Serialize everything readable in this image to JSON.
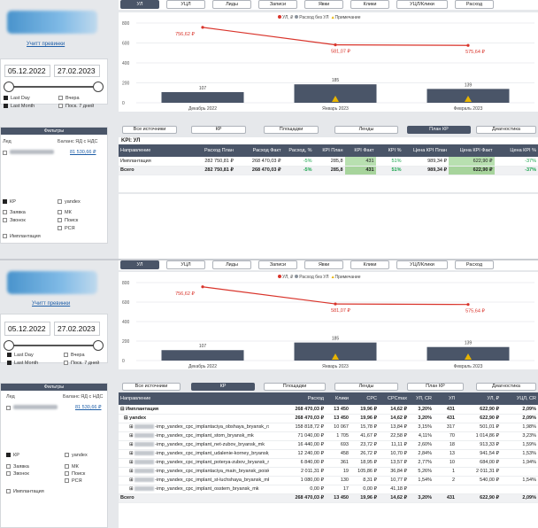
{
  "left": {
    "help_link": "Учитт превинки",
    "date_from": "05.12.2022",
    "date_to": "27.02.2023",
    "period_options": [
      "Last Day",
      "Вчера",
      "Last Month",
      "Поск. 7 дней"
    ],
    "filters_title": "Фильтры",
    "col_led": "Лед",
    "col_balance": "Баланс ЯД с НДС",
    "balance_value": "81 530,66 ₽",
    "channels": [
      "КР",
      "yandex",
      "Заявка",
      "МК",
      "Звонок",
      "Поиск",
      "РСЯ",
      "Имплантация"
    ]
  },
  "tabs": [
    "УЛ",
    "УЦЛ",
    "Лиды",
    "Записи",
    "Явки",
    "Клики",
    "УЦЛ/Клики",
    "Расход"
  ],
  "active_tab": "УЛ",
  "chart": {
    "legend": "● УЛ, ₽ ● Расход без УЛ ▲ Примечание",
    "legend_items": [
      "УЛ, ₽",
      "Расход без УЛ",
      "Примечание"
    ],
    "colors": {
      "line": "#d9342b",
      "bar": "#4a5568",
      "note": "#e8b400"
    },
    "chart_data": {
      "type": "bar",
      "categories": [
        "Декабрь 2022",
        "Январь 2023",
        "Февраль 2023"
      ],
      "series": [
        {
          "name": "Расход без УЛ",
          "values": [
            107,
            185,
            139
          ]
        },
        {
          "name": "УЛ, ₽",
          "values": [
            756.62,
            581.07,
            575.64
          ]
        }
      ],
      "line_labels": [
        "756,62 ₽",
        "581,07 ₽",
        "575,64 ₽"
      ],
      "y_ticks": [
        "800",
        "600",
        "400",
        "200",
        "0"
      ],
      "ylim": [
        0,
        800
      ]
    }
  },
  "sources": [
    "Все источники",
    "КР",
    "Площадки",
    "Ленды",
    "План КР",
    "Диагностика"
  ],
  "view1": {
    "active_source": "План КР",
    "kpi_title": "KPI: УЛ",
    "headers": [
      "Направление",
      "Расход План",
      "Расход Факт",
      "Расход, %",
      "КРІ План",
      "КРІ Факт",
      "КРІ %",
      "Цена КРІ План",
      "Цена КРІ Факт",
      "Цена КРІ %"
    ],
    "rows": [
      [
        "Имплантация",
        "282 750,81 ₽",
        "268 470,03 ₽",
        "-5%",
        "285,8",
        "431",
        "51%",
        "989,34 ₽",
        "622,90 ₽",
        "-37%"
      ]
    ],
    "total": [
      "Всего",
      "282 750,81 ₽",
      "268 470,03 ₽",
      "-5%",
      "285,8",
      "431",
      "51%",
      "989,34 ₽",
      "622,90 ₽",
      "-37%"
    ]
  },
  "view2": {
    "active_source": "КР",
    "headers": [
      "Направление",
      "Расход",
      "Клики",
      "CPC",
      "CPCmax",
      "УЛ, CR",
      "УЛ",
      "УЛ, ₽",
      "УЦЛ, CR"
    ],
    "group": [
      "⊟ Имплантация",
      "268 470,03 ₽",
      "13 450",
      "19,96 ₽",
      "14,62 ₽",
      "3,20%",
      "431",
      "622,90 ₽",
      "2,09%"
    ],
    "subgroup": [
      "⊟ yandex",
      "268 470,03 ₽",
      "13 450",
      "19,96 ₽",
      "14,62 ₽",
      "3,20%",
      "431",
      "622,90 ₽",
      "2,09%"
    ],
    "rows": [
      [
        "-imp_yandex_cpc_implantaciya_obshaya_bryansk_rsya",
        "158 818,72 ₽",
        "10 067",
        "15,78 ₽",
        "13,84 ₽",
        "3,15%",
        "317",
        "501,01 ₽",
        "1,98%"
      ],
      [
        "-imp_yandex_cpc_implant_stom_bryansk_mk",
        "71 040,00 ₽",
        "1 705",
        "41,67 ₽",
        "22,58 ₽",
        "4,11%",
        "70",
        "1 014,86 ₽",
        "3,23%"
      ],
      [
        "-imp_yandex_cpc_implant_net-zubov_bryansk_mk",
        "16 440,00 ₽",
        "693",
        "23,72 ₽",
        "11,11 ₽",
        "2,60%",
        "18",
        "913,33 ₽",
        "1,59%"
      ],
      [
        "-imp_yandex_cpc_implant_udalenie-korney_bryansk_mk",
        "12 240,00 ₽",
        "458",
        "26,72 ₽",
        "10,70 ₽",
        "2,84%",
        "13",
        "941,54 ₽",
        "1,53%"
      ],
      [
        "-imp_yandex_cpc_implant_poterya-zubov_bryansk_mk",
        "6 840,00 ₽",
        "361",
        "18,95 ₽",
        "13,57 ₽",
        "2,77%",
        "10",
        "684,00 ₽",
        "1,94%"
      ],
      [
        "-imp_yandex_cpc_implantaciya_main_bryansk_poisk",
        "2 011,31 ₽",
        "19",
        "105,86 ₽",
        "36,84 ₽",
        "5,26%",
        "1",
        "2 011,31 ₽",
        ""
      ],
      [
        "-imp_yandex_cpc_implant_st-luchshaya_bryansk_mk",
        "1 080,00 ₽",
        "130",
        "8,31 ₽",
        "10,77 ₽",
        "1,54%",
        "2",
        "540,00 ₽",
        "1,54%"
      ],
      [
        "-imp_yandex_cpc_implant_osstem_bryansk_mk",
        "0,00 ₽",
        "17",
        "0,00 ₽",
        "41,18 ₽",
        "",
        "",
        "",
        ""
      ]
    ],
    "total": [
      "Всего",
      "268 470,03 ₽",
      "13 450",
      "19,96 ₽",
      "14,62 ₽",
      "3,20%",
      "431",
      "622,90 ₽",
      "2,09%"
    ]
  }
}
